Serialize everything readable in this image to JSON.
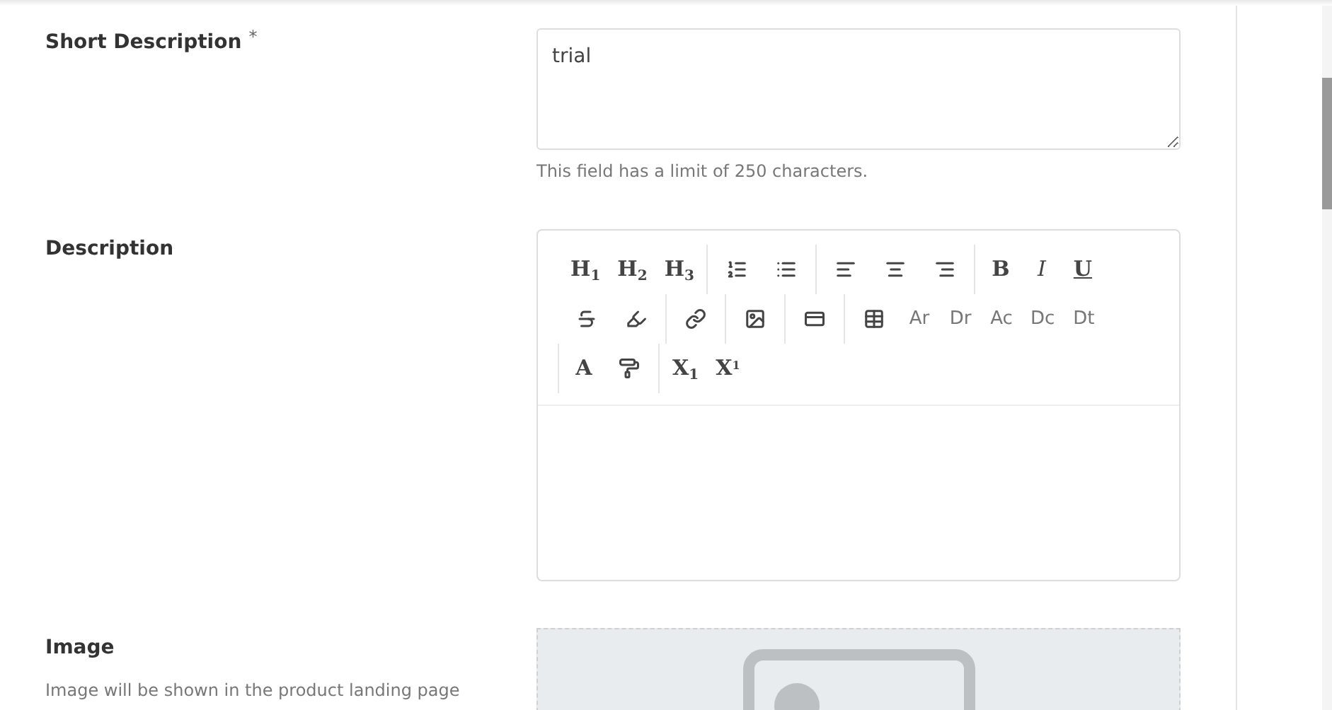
{
  "fields": [
    {
      "kind": "textarea",
      "label": "Short Description",
      "required_mark": "*",
      "value": "trial",
      "hint": "This field has a limit of 250 characters."
    },
    {
      "kind": "editor",
      "label": "Description",
      "toolbar_rows": [
        [
          [
            {
              "kind": "heading",
              "label": "H$_{1}$"
            },
            {
              "kind": "heading",
              "label": "H$_{2}$"
            },
            {
              "kind": "heading",
              "label": "H$_{3}$"
            }
          ],
          [
            {
              "kind": "olist"
            },
            {
              "kind": "ulist"
            }
          ],
          [
            {
              "kind": "alignleft"
            },
            {
              "kind": "aligncenter"
            },
            {
              "kind": "alignright"
            }
          ],
          [
            {
              "kind": "bold",
              "label": "B"
            },
            {
              "kind": "italic",
              "label": "I"
            },
            {
              "kind": "underline",
              "label": "U"
            }
          ]
        ],
        [
          [
            {
              "kind": "strike"
            },
            {
              "kind": "highlight"
            }
          ],
          [
            {
              "kind": "link"
            }
          ],
          [
            {
              "kind": "image"
            }
          ],
          [
            {
              "kind": "embed"
            }
          ],
          [
            {
              "kind": "table"
            },
            {
              "kind": "shortcut",
              "label": "Ar"
            },
            {
              "kind": "shortcut",
              "label": "Dr"
            },
            {
              "kind": "shortcut",
              "label": "Ac"
            },
            {
              "kind": "shortcut",
              "label": "Dc"
            },
            {
              "kind": "shortcut",
              "label": "Dt"
            }
          ]
        ],
        [
          [
            {
              "kind": "color",
              "label": "A"
            },
            {
              "kind": "paint"
            }
          ],
          [
            {
              "kind": "script",
              "label": "X$_{1}$"
            },
            {
              "kind": "script",
              "label": "X$^{1}$"
            }
          ]
        ]
      ]
    },
    {
      "kind": "image",
      "label": "Image",
      "description": "Image will be shown in the product landing page"
    }
  ]
}
